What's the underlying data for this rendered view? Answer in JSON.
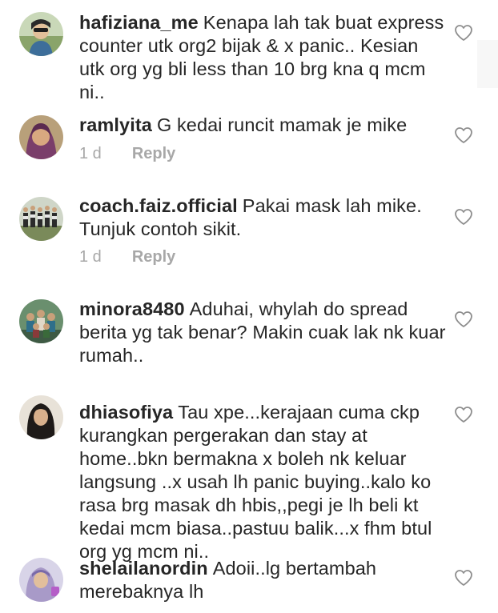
{
  "comments": [
    {
      "username": "hafiziana_me",
      "text": "Kenapa lah tak buat express counter  utk org2 bijak & x panic.. Kesian utk org yg bli less than 10 brg kna q mcm ni..",
      "avatar_icon": "user-avatar-hafiziana",
      "like_icon": "heart-outline-icon"
    },
    {
      "username": "ramlyita",
      "text": "G kedai runcit mamak je mike",
      "time": "1 d",
      "reply": "Reply",
      "avatar_icon": "user-avatar-ramlyita",
      "like_icon": "heart-outline-icon"
    },
    {
      "username": "coach.faiz.official",
      "text": "Pakai mask lah mike. Tunjuk contoh sikit.",
      "time": "1 d",
      "reply": "Reply",
      "avatar_icon": "user-avatar-coach-faiz",
      "like_icon": "heart-outline-icon"
    },
    {
      "username": "minora8480",
      "text": "Aduhai, whylah do spread berita yg tak benar? Makin cuak lak nk kuar rumah..",
      "avatar_icon": "user-avatar-minora",
      "like_icon": "heart-outline-icon"
    },
    {
      "username": "dhiasofiya",
      "text": "Tau xpe...kerajaan cuma ckp kurangkan pergerakan dan stay at home..bkn bermakna x boleh nk keluar langsung ..x usah lh panic buying..kalo ko rasa brg masak dh hbis,,pegi je lh beli kt kedai mcm biasa..pastuu balik...x fhm btul org yg mcm ni..",
      "avatar_icon": "user-avatar-dhiasofiya",
      "like_icon": "heart-outline-icon"
    },
    {
      "username": "shelailanordin",
      "text": "Adoii..lg bertambah merebaknya lh",
      "avatar_icon": "user-avatar-shelailanordin",
      "like_icon": "heart-outline-icon"
    }
  ],
  "colors": {
    "text": "#262626",
    "meta": "#a8a8a8",
    "heart": "#8e8e8e"
  }
}
